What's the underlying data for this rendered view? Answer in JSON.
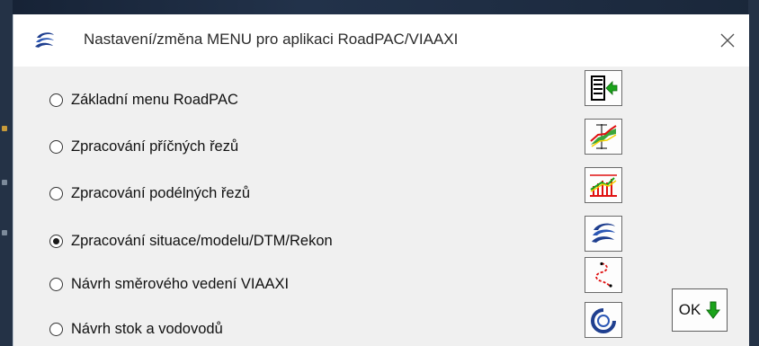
{
  "dialog": {
    "title": "Nastavení/změna MENU pro aplikaci RoadPAC/VIAAXI",
    "app_icon": "roadpac-logo-icon",
    "close_icon": "close-icon"
  },
  "options": [
    {
      "label": "Základní menu RoadPAC",
      "selected": false,
      "icon": "document-exit-icon"
    },
    {
      "label": "Zpracování příčných řezů",
      "selected": false,
      "icon": "cross-section-icon"
    },
    {
      "label": "Zpracování podélných řezů",
      "selected": false,
      "icon": "longitudinal-profile-icon"
    },
    {
      "label": "Zpracování situace/modelu/DTM/Rekon",
      "selected": true,
      "icon": "roadpac-logo-icon"
    },
    {
      "label": "Návrh směrového vedení VIAAXI",
      "selected": false,
      "icon": "route-alignment-icon"
    },
    {
      "label": "Návrh stok a vodovodů",
      "selected": false,
      "icon": "sewer-pipe-icon"
    }
  ],
  "ok_button": {
    "label": "OK",
    "icon": "green-down-arrow-icon"
  },
  "colors": {
    "dialog_bg": "#f0f0f0",
    "titlebar_bg": "#ffffff",
    "arrow_green": "#1aa31a",
    "logo_blue": "#1f3f8f"
  }
}
